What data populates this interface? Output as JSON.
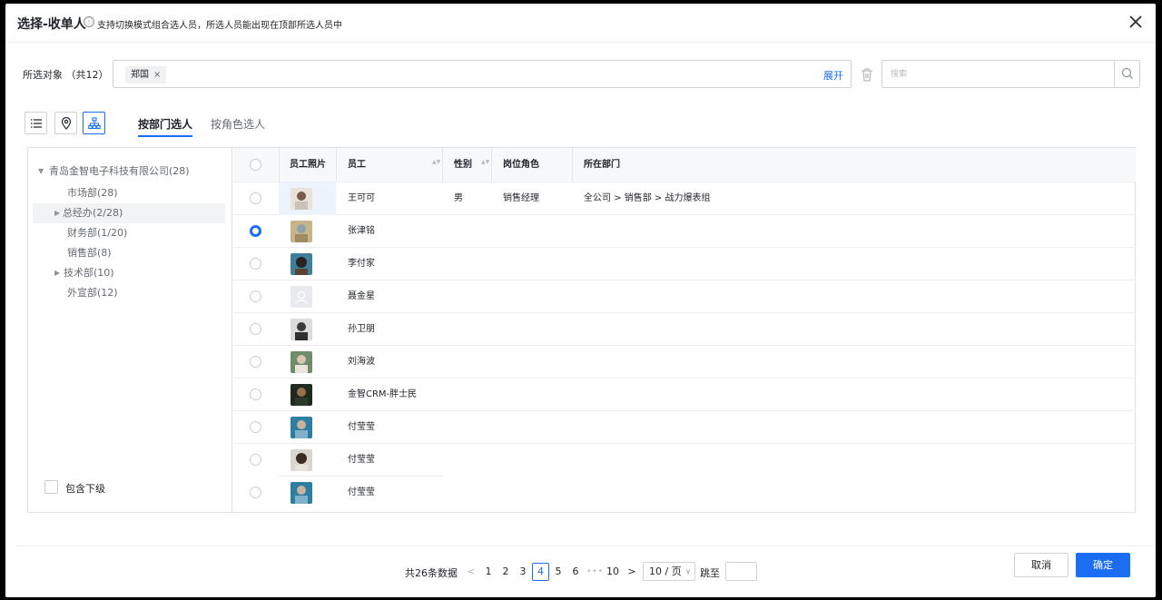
{
  "dialog": {
    "title": "选择-收单人",
    "info_icon": "ⓘ",
    "hint": "支持切换模式组合选人员，所选人员能出现在顶部所选人员中"
  },
  "selected": {
    "label": "所选对象 （共12）",
    "tags": [
      {
        "label": "郑国"
      }
    ],
    "expand_label": "展开"
  },
  "search": {
    "placeholder": "搜索"
  },
  "tabs": [
    {
      "label": "按部门选人",
      "active": true
    },
    {
      "label": "按角色选人",
      "active": false
    }
  ],
  "tree": {
    "items": [
      {
        "label": "青岛金智电子科技有限公司(28)",
        "caret": "▼"
      },
      {
        "label": "市场部(28)"
      },
      {
        "label": "总经办(2/28)",
        "caret": "▶"
      },
      {
        "label": "财务部(1/20)"
      },
      {
        "label": "销售部(8)"
      },
      {
        "label": "技术部(10)",
        "caret": "▶"
      },
      {
        "label": "外宣部(12)"
      }
    ],
    "include_label": "包含下级"
  },
  "table": {
    "columns": [
      "员工照片",
      "员工",
      "性别",
      "岗位角色",
      "所在部门"
    ],
    "sort_icon": "▲▼",
    "rows": [
      {
        "name": "王可可",
        "gender": "男",
        "role": "销售经理",
        "dept": "全公司 > 销售部 > 战力爆表组",
        "selected": false
      },
      {
        "name": "张津铭",
        "gender": "",
        "role": "",
        "dept": "",
        "selected": true
      },
      {
        "name": "李付家",
        "gender": "",
        "role": "",
        "dept": "",
        "selected": false
      },
      {
        "name": "聂金星",
        "gender": "",
        "role": "",
        "dept": "",
        "selected": false
      },
      {
        "name": "孙卫朋",
        "gender": "",
        "role": "",
        "dept": "",
        "selected": false
      },
      {
        "name": "刘海波",
        "gender": "",
        "role": "",
        "dept": "",
        "selected": false
      },
      {
        "name": "金智CRM-胖士民",
        "gender": "",
        "role": "",
        "dept": "",
        "selected": false
      },
      {
        "name": "付莹莹",
        "gender": "",
        "role": "",
        "dept": "",
        "selected": false
      },
      {
        "name": "付莹莹",
        "gender": "",
        "role": "",
        "dept": "",
        "selected": false
      },
      {
        "name": "付莹莹",
        "gender": "",
        "role": "",
        "dept": "",
        "selected": false
      }
    ]
  },
  "pagination": {
    "total": "共26条数据",
    "prev": "<",
    "next": ">",
    "pages": [
      "1",
      "2",
      "3",
      "4",
      "5",
      "6",
      "10"
    ],
    "current": "4",
    "ellipsis": "•••",
    "page_size": "10 / 页",
    "page_size_chevron": "∨",
    "jump_label": "跳至",
    "jump_value": ""
  },
  "buttons": {
    "cancel": "取消",
    "ok": "确定"
  },
  "colors": {
    "accent": "#1b6ef3",
    "border": "#d0d3d6"
  }
}
